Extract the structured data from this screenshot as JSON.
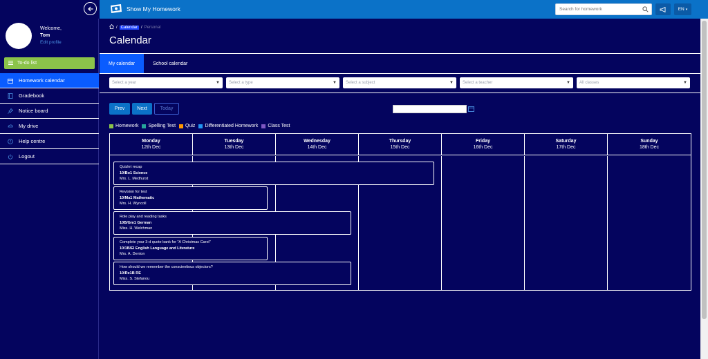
{
  "app": {
    "title": "Show My Homework"
  },
  "search": {
    "placeholder": "Search for homework"
  },
  "lang": {
    "label": "EN"
  },
  "user": {
    "welcome": "Welcome,",
    "name": "Tom",
    "edit_profile": "Edit profile"
  },
  "todo": {
    "label": "To-do list"
  },
  "sidebar": {
    "items": [
      {
        "label": "Homework calendar",
        "icon": "calendar-icon"
      },
      {
        "label": "Gradebook",
        "icon": "book-icon"
      },
      {
        "label": "Notice board",
        "icon": "pin-icon"
      },
      {
        "label": "My drive",
        "icon": "drive-icon"
      },
      {
        "label": "Help centre",
        "icon": "help-icon"
      },
      {
        "label": "Logout",
        "icon": "power-icon"
      }
    ]
  },
  "breadcrumb": {
    "sep": "/",
    "current": "Calendar",
    "child": "Personal"
  },
  "page": {
    "title": "Calendar"
  },
  "tabs": [
    {
      "label": "My calendar"
    },
    {
      "label": "School calendar"
    }
  ],
  "filters": [
    {
      "placeholder": "Select a year"
    },
    {
      "placeholder": "Select a type"
    },
    {
      "placeholder": "Select a subject"
    },
    {
      "placeholder": "Select a teacher"
    },
    {
      "placeholder": "All classes"
    }
  ],
  "buttons": {
    "prev": "Prev",
    "next": "Next",
    "today": "Today"
  },
  "legend": [
    {
      "label": "Homework",
      "color": "#8bc34a"
    },
    {
      "label": "Spelling Test",
      "color": "#26a69a"
    },
    {
      "label": "Quiz",
      "color": "#ff9800"
    },
    {
      "label": "Differentiated Homework",
      "color": "#2196f3"
    },
    {
      "label": "Class Test",
      "color": "#7e57c2"
    }
  ],
  "days": [
    {
      "name": "Monday",
      "date": "12th Dec"
    },
    {
      "name": "Tuesday",
      "date": "13th Dec"
    },
    {
      "name": "Wednesday",
      "date": "14th Dec"
    },
    {
      "name": "Thursday",
      "date": "15th Dec"
    },
    {
      "name": "Friday",
      "date": "16th Dec"
    },
    {
      "name": "Saturday",
      "date": "17th Dec"
    },
    {
      "name": "Sunday",
      "date": "18th Dec"
    }
  ],
  "events": [
    {
      "title": "Quizlet recap",
      "class": "10/Bo1 Science",
      "teacher": "Mrs. L. Medhurst"
    },
    {
      "title": "Revision for test",
      "class": "10/Ma1 Mathematic",
      "teacher": "Mrs. H. Wyncoll"
    },
    {
      "title": "Role play and reading tasks",
      "class": "10B/Gm1 German",
      "teacher": "Miss. H. Welchman"
    },
    {
      "title": "Complete your 3-d quote bank for \"A Christmas Carol\"",
      "class": "10/1B/El English Language and Literature",
      "teacher": "Mrs. A. Denton"
    },
    {
      "title": "How should we remember the conscientious objectors?",
      "class": "10/Re1B RE",
      "teacher": "Miss. S. Stefanou"
    }
  ]
}
